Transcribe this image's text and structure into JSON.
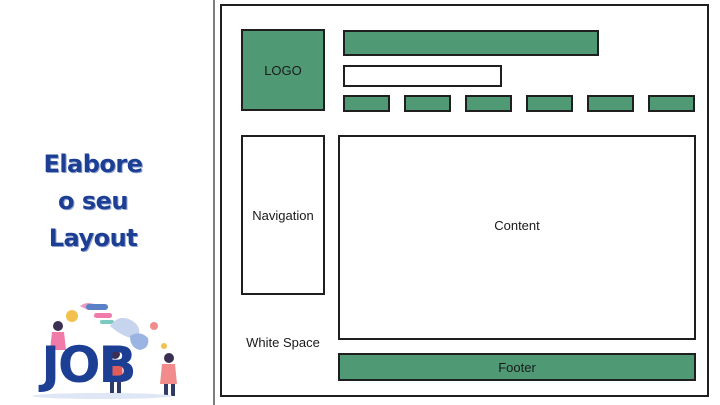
{
  "slide": {
    "title_lines": [
      "Elabore",
      "o seu",
      "Layout"
    ],
    "illustration_text": "JOB"
  },
  "wireframe": {
    "logo_label": "LOGO",
    "navigation_label": "Navigation",
    "content_label": "Content",
    "whitespace_label": "White Space",
    "footer_label": "Footer",
    "nav_tab_count": 6
  },
  "colors": {
    "title": "#1c3f94",
    "block_green": "#4f9a75",
    "outline": "#1f1f1f",
    "divider": "#7d7d7d"
  }
}
